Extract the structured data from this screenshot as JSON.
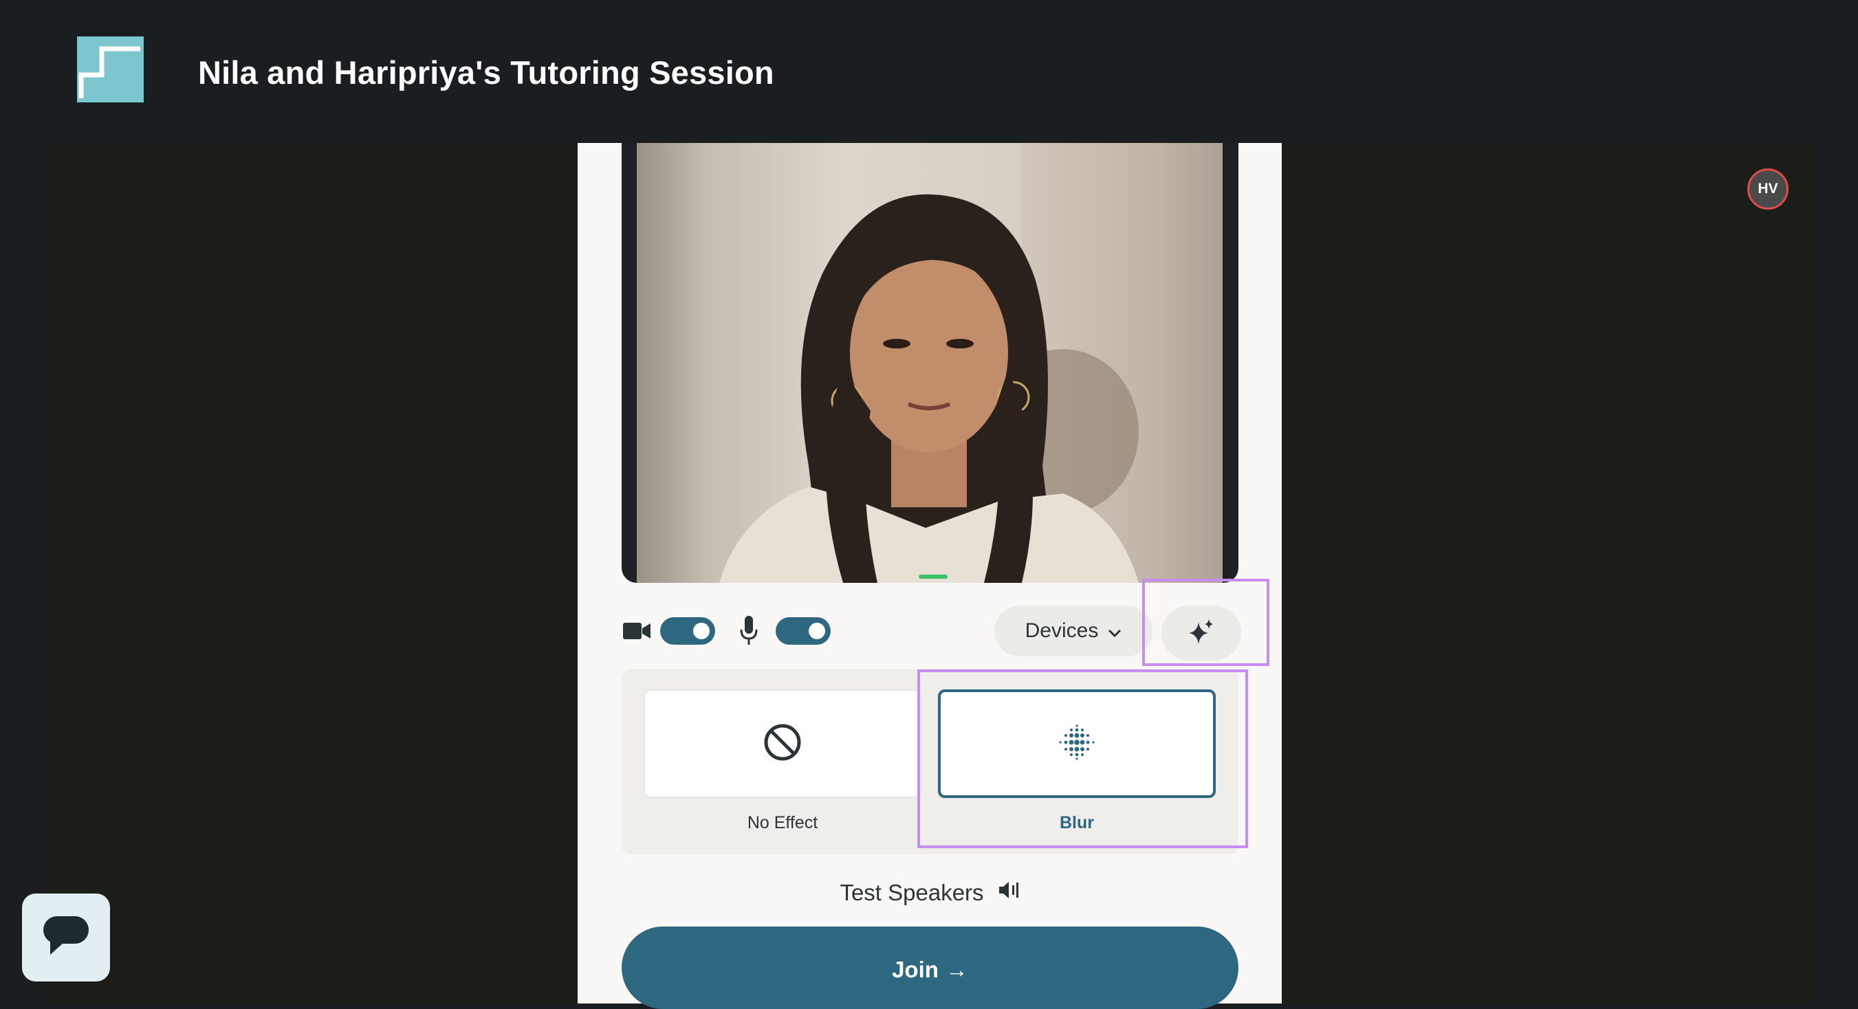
{
  "header": {
    "title": "Nila and Haripriya's Tutoring Session",
    "logo_icon": "stairs-logo-icon"
  },
  "user": {
    "avatar_initials": "HV"
  },
  "prejoin": {
    "camera": {
      "icon": "video-camera-icon",
      "enabled": true
    },
    "microphone": {
      "icon": "microphone-icon",
      "enabled": true
    },
    "devices_label": "Devices",
    "effects_button_icon": "sparkles-icon",
    "effects": [
      {
        "label": "No Effect",
        "icon": "prohibited-icon",
        "selected": false
      },
      {
        "label": "Blur",
        "icon": "blur-dots-icon",
        "selected": true
      }
    ],
    "test_speakers_label": "Test Speakers",
    "join_label": "Join",
    "join_arrow": "→"
  },
  "colors": {
    "accent": "#2e6780",
    "highlight": "#c98cf0",
    "background": "#1a1e20",
    "panel": "#f9f8f6"
  }
}
